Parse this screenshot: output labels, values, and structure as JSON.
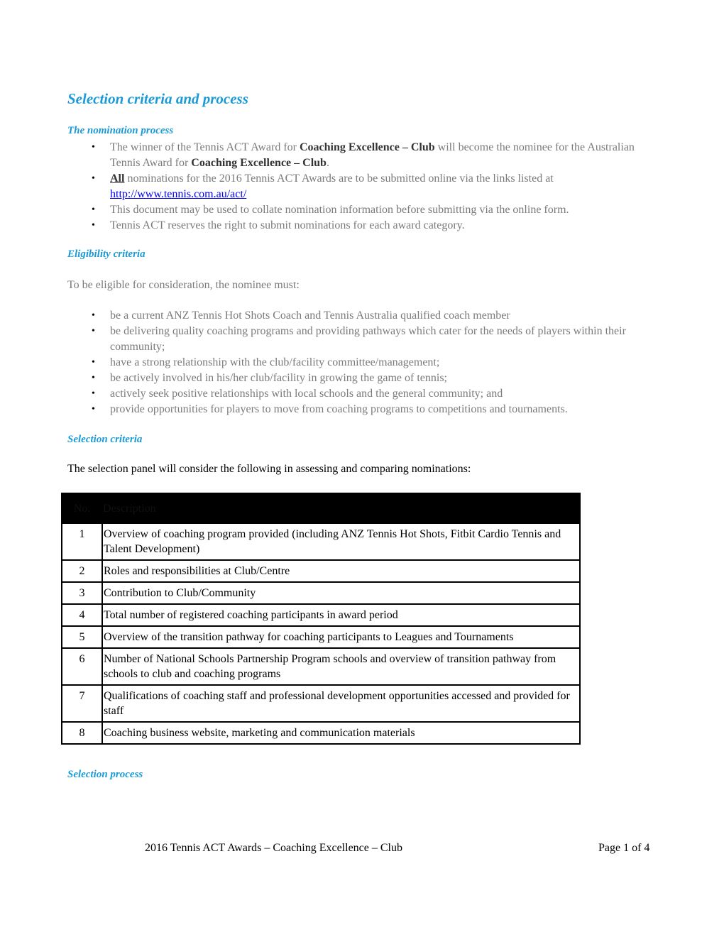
{
  "title": "Selection criteria and process",
  "nomination": {
    "heading": "The nomination process",
    "bullets": [
      {
        "parts": [
          {
            "text": "The winner of the Tennis ACT Award for ",
            "style": "normal"
          },
          {
            "text": "Coaching Excellence – Club",
            "style": "bold"
          },
          {
            "text": " will become the nominee for the Australian Tennis Award for ",
            "style": "normal"
          },
          {
            "text": "Coaching Excellence – Club",
            "style": "bold"
          },
          {
            "text": ".",
            "style": "normal"
          }
        ]
      },
      {
        "parts": [
          {
            "text": "All",
            "style": "bold-underline"
          },
          {
            "text": " nominations for the 2016 Tennis ACT Awards are to be submitted online via the links listed at ",
            "style": "normal"
          },
          {
            "text": "http://www.tennis.com.au/act/",
            "style": "link"
          }
        ]
      },
      {
        "parts": [
          {
            "text": "This document may be used to collate nomination information before submitting via the online form.",
            "style": "normal"
          }
        ]
      },
      {
        "parts": [
          {
            "text": "Tennis ACT reserves the right to submit nominations for each award category.",
            "style": "normal"
          }
        ]
      }
    ]
  },
  "eligibility": {
    "heading": "Eligibility criteria",
    "intro": "To be eligible for consideration, the nominee must:",
    "bullets": [
      "be a current ANZ Tennis Hot Shots Coach and Tennis Australia qualified coach member",
      "be delivering quality coaching programs and providing pathways which cater for the needs of players within their community;",
      "have a strong relationship with the club/facility committee/management;",
      "be actively involved in his/her club/facility in growing the game of tennis;",
      "actively seek positive relationships with local schools and the general community; and",
      "provide opportunities for players to move from coaching programs to competitions and tournaments."
    ]
  },
  "selection_criteria": {
    "heading": "Selection criteria",
    "intro": "The selection panel will consider the following in assessing and comparing nominations:",
    "table": {
      "headers": [
        "No.",
        "Description"
      ],
      "rows": [
        {
          "no": "1",
          "desc": "Overview of coaching program provided (including ANZ Tennis Hot Shots, Fitbit Cardio Tennis and Talent Development)"
        },
        {
          "no": "2",
          "desc": "Roles and responsibilities at Club/Centre"
        },
        {
          "no": "3",
          "desc": "Contribution to Club/Community"
        },
        {
          "no": "4",
          "desc": "Total number of registered coaching participants in award period"
        },
        {
          "no": "5",
          "desc": "Overview of the transition pathway for coaching participants to Leagues and Tournaments"
        },
        {
          "no": "6",
          "desc": "Number of National Schools Partnership Program schools and overview of transition pathway from schools to club and coaching programs"
        },
        {
          "no": "7",
          "desc": "Qualifications of coaching staff and professional development opportunities accessed and provided for staff"
        },
        {
          "no": "8",
          "desc": "Coaching business website, marketing and communication materials"
        }
      ]
    }
  },
  "selection_process": {
    "heading": "Selection process"
  },
  "footer": {
    "left": "2016 Tennis ACT Awards – Coaching Excellence – Club",
    "right": "Page 1 of 4"
  },
  "colors": {
    "heading": "#1a9ad6",
    "body_gray": "#7a7a7a",
    "link": "#0000ee"
  }
}
